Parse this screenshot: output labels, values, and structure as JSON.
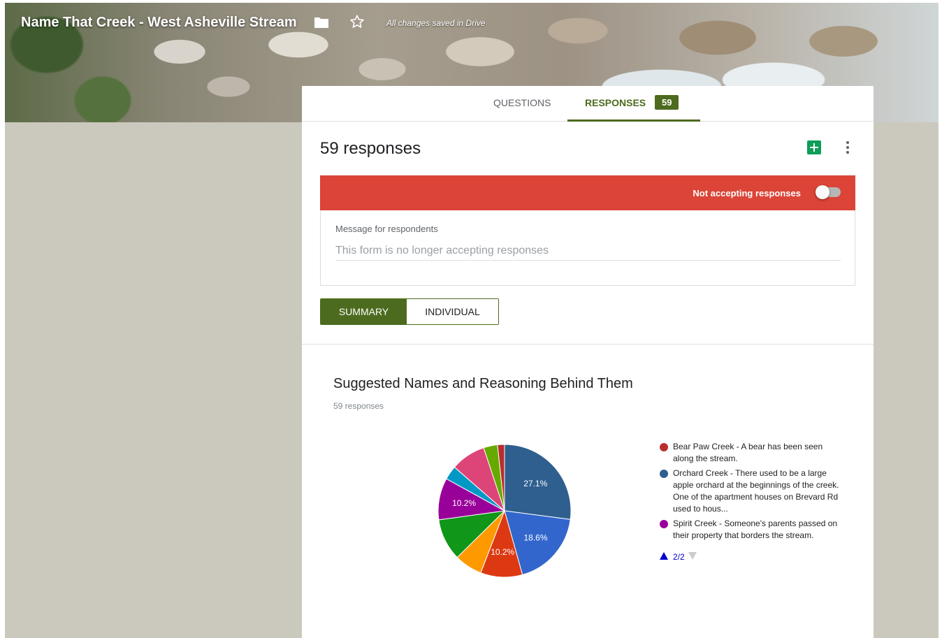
{
  "header": {
    "title": "Name That Creek - West Asheville Stream",
    "save_status": "All changes saved in Drive"
  },
  "tabs": {
    "questions": "QUESTIONS",
    "responses": "RESPONSES",
    "responses_badge": "59"
  },
  "summary": {
    "count_label": "59 responses",
    "banner_text": "Not accepting responses",
    "accepting": false,
    "message_label": "Message for respondents",
    "message_value": "This form is no longer accepting responses"
  },
  "view_toggle": {
    "summary": "SUMMARY",
    "individual": "INDIVIDUAL",
    "selected": "SUMMARY"
  },
  "question": {
    "title": "Suggested Names and Reasoning Behind Them",
    "responses": "59 responses"
  },
  "colors": {
    "accent": "#4d6b1e",
    "banner": "#db4437"
  },
  "chart_data": {
    "type": "pie",
    "slices": [
      {
        "color": "#2f5f8f",
        "value": 27.1,
        "label": "27.1%"
      },
      {
        "color": "#3366cc",
        "value": 18.6,
        "label": "18.6%"
      },
      {
        "color": "#dc3912",
        "value": 10.2,
        "label": "10.2%"
      },
      {
        "color": "#ff9900",
        "value": 6.8,
        "label": ""
      },
      {
        "color": "#109618",
        "value": 10.2,
        "label": ""
      },
      {
        "color": "#990099",
        "value": 10.2,
        "label": "10.2%"
      },
      {
        "color": "#0099c6",
        "value": 3.4,
        "label": ""
      },
      {
        "color": "#dd4477",
        "value": 8.5,
        "label": ""
      },
      {
        "color": "#66aa00",
        "value": 3.4,
        "label": ""
      },
      {
        "color": "#b82e2e",
        "value": 1.7,
        "label": ""
      }
    ],
    "legend": [
      {
        "color": "#b82e2e",
        "text": "Bear Paw Creek - A bear has been seen along the stream."
      },
      {
        "color": "#2f5f8f",
        "text": "Orchard Creek - There used to be a large apple orchard at the beginnings of the creek. One of the apartment houses on Brevard Rd used to hous..."
      },
      {
        "color": "#990099",
        "text": "Spirit Creek - Someone's parents passed on their property that borders the stream."
      }
    ],
    "legend_page": "2/2"
  }
}
